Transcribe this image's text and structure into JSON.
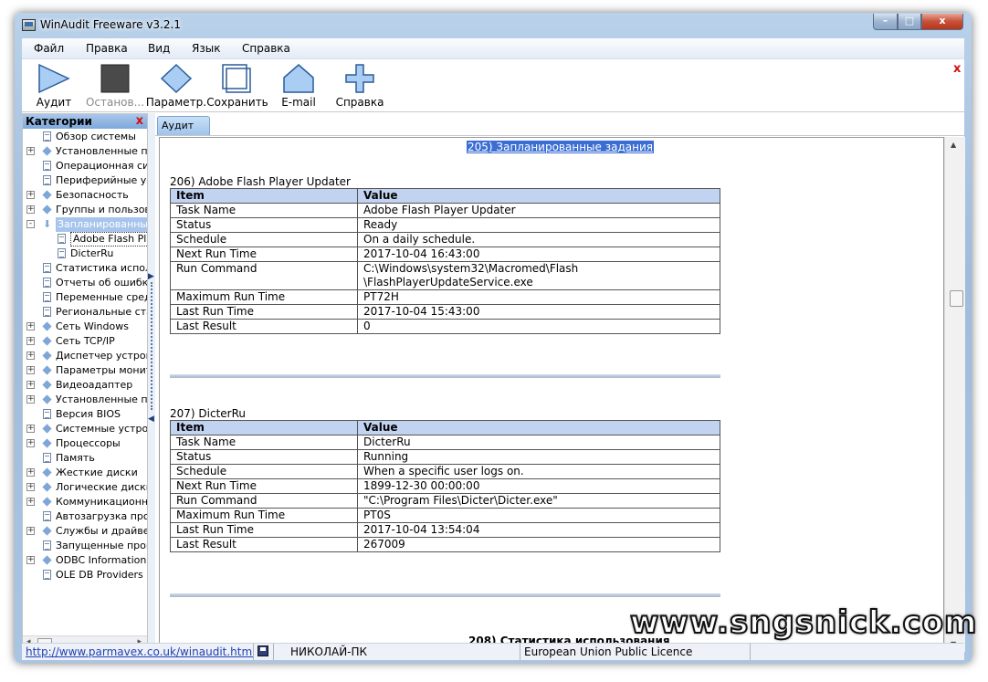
{
  "window": {
    "title": "WinAudit Freeware v3.2.1",
    "min": "–",
    "max": "□",
    "close": "x"
  },
  "menu": [
    "Файл",
    "Правка",
    "Вид",
    "Язык",
    "Справка"
  ],
  "toolbar": {
    "buttons": [
      {
        "label": "Аудит",
        "icon": "play-icon",
        "disabled": false
      },
      {
        "label": "Останов...",
        "icon": "stop-icon",
        "disabled": true
      },
      {
        "label": "Параметр.",
        "icon": "diamond-icon",
        "disabled": false
      },
      {
        "label": "Сохранить",
        "icon": "save-icon",
        "disabled": false
      },
      {
        "label": "E-mail",
        "icon": "house-icon",
        "disabled": false
      },
      {
        "label": "Справка",
        "icon": "plus-icon",
        "disabled": false
      }
    ],
    "close": "x"
  },
  "sidebar": {
    "header": "Категории",
    "close": "x",
    "items": [
      {
        "label": "Обзор системы",
        "icon": "doc",
        "expander": ""
      },
      {
        "label": "Установленные про",
        "icon": "diamond",
        "expander": "+"
      },
      {
        "label": "Операционная сист",
        "icon": "doc",
        "expander": ""
      },
      {
        "label": "Периферийные устр",
        "icon": "doc",
        "expander": ""
      },
      {
        "label": "Безопасность",
        "icon": "diamond",
        "expander": "+"
      },
      {
        "label": "Группы и пользовате",
        "icon": "diamond",
        "expander": "+"
      },
      {
        "label": "Запланированные з",
        "icon": "arrow",
        "expander": "-",
        "selected": true
      },
      {
        "label": "Adobe Flash Play",
        "icon": "doc",
        "expander": "",
        "child": true,
        "focused": true
      },
      {
        "label": "DicterRu",
        "icon": "doc",
        "expander": "",
        "child": true
      },
      {
        "label": "Статистика использ",
        "icon": "doc",
        "expander": ""
      },
      {
        "label": "Отчеты об ошибках",
        "icon": "doc",
        "expander": ""
      },
      {
        "label": "Переменные среды",
        "icon": "doc",
        "expander": ""
      },
      {
        "label": "Региональные стан",
        "icon": "doc",
        "expander": ""
      },
      {
        "label": "Сеть Windows",
        "icon": "diamond",
        "expander": "+"
      },
      {
        "label": "Сеть TCP/IP",
        "icon": "diamond",
        "expander": "+"
      },
      {
        "label": "Диспетчер устройст",
        "icon": "diamond",
        "expander": "+"
      },
      {
        "label": "Параметры монито",
        "icon": "diamond",
        "expander": "+"
      },
      {
        "label": "Видеоадаптер",
        "icon": "diamond",
        "expander": "+"
      },
      {
        "label": "Установленные при",
        "icon": "diamond",
        "expander": "+"
      },
      {
        "label": "Версия BIOS",
        "icon": "doc",
        "expander": ""
      },
      {
        "label": "Системные устройс",
        "icon": "diamond",
        "expander": "+"
      },
      {
        "label": "Процессоры",
        "icon": "diamond",
        "expander": "+"
      },
      {
        "label": "Память",
        "icon": "doc",
        "expander": ""
      },
      {
        "label": "Жесткие диски",
        "icon": "diamond",
        "expander": "+"
      },
      {
        "label": "Логические диски",
        "icon": "diamond",
        "expander": "+"
      },
      {
        "label": "Коммуникационные",
        "icon": "diamond",
        "expander": "+"
      },
      {
        "label": "Автозагрузка прогр",
        "icon": "doc",
        "expander": ""
      },
      {
        "label": "Службы и драйвера",
        "icon": "diamond",
        "expander": "+"
      },
      {
        "label": "Запущенные програ",
        "icon": "doc",
        "expander": ""
      },
      {
        "label": "ODBC Information",
        "icon": "diamond",
        "expander": "+"
      },
      {
        "label": "OLE DB Providers",
        "icon": "doc",
        "expander": ""
      }
    ]
  },
  "tabs": [
    "Аудит"
  ],
  "report": {
    "heading": "205) Запланированные задания",
    "sections": [
      {
        "title": "206) Adobe Flash Player Updater",
        "header": [
          "Item",
          "Value"
        ],
        "rows": [
          [
            "Task Name",
            "Adobe Flash Player Updater"
          ],
          [
            "Status",
            "Ready"
          ],
          [
            "Schedule",
            "On a daily schedule."
          ],
          [
            "Next Run Time",
            "2017-10-04 16:43:00"
          ],
          [
            "Run Command",
            "C:\\Windows\\system32\\Macromed\\Flash\n\\FlashPlayerUpdateService.exe"
          ],
          [
            "Maximum Run Time",
            "PT72H"
          ],
          [
            "Last Run Time",
            "2017-10-04 15:43:00"
          ],
          [
            "Last Result",
            "0"
          ]
        ]
      },
      {
        "title": "207) DicterRu",
        "header": [
          "Item",
          "Value"
        ],
        "rows": [
          [
            "Task Name",
            "DicterRu"
          ],
          [
            "Status",
            "Running"
          ],
          [
            "Schedule",
            "When a specific user logs on."
          ],
          [
            "Next Run Time",
            "1899-12-30 00:00:00"
          ],
          [
            "Run Command",
            "\"C:\\Program Files\\Dicter\\Dicter.exe\""
          ],
          [
            "Maximum Run Time",
            "PT0S"
          ],
          [
            "Last Run Time",
            "2017-10-04 13:54:04"
          ],
          [
            "Last Result",
            "267009"
          ]
        ]
      }
    ],
    "next_heading_partial": "208) Статистика использования"
  },
  "watermark": "www.sngsnick.com",
  "statusbar": {
    "link": "http://www.parmavex.co.uk/winaudit.html",
    "computer": "НИКОЛАЙ-ПК",
    "licence": "European Union Public Licence"
  }
}
